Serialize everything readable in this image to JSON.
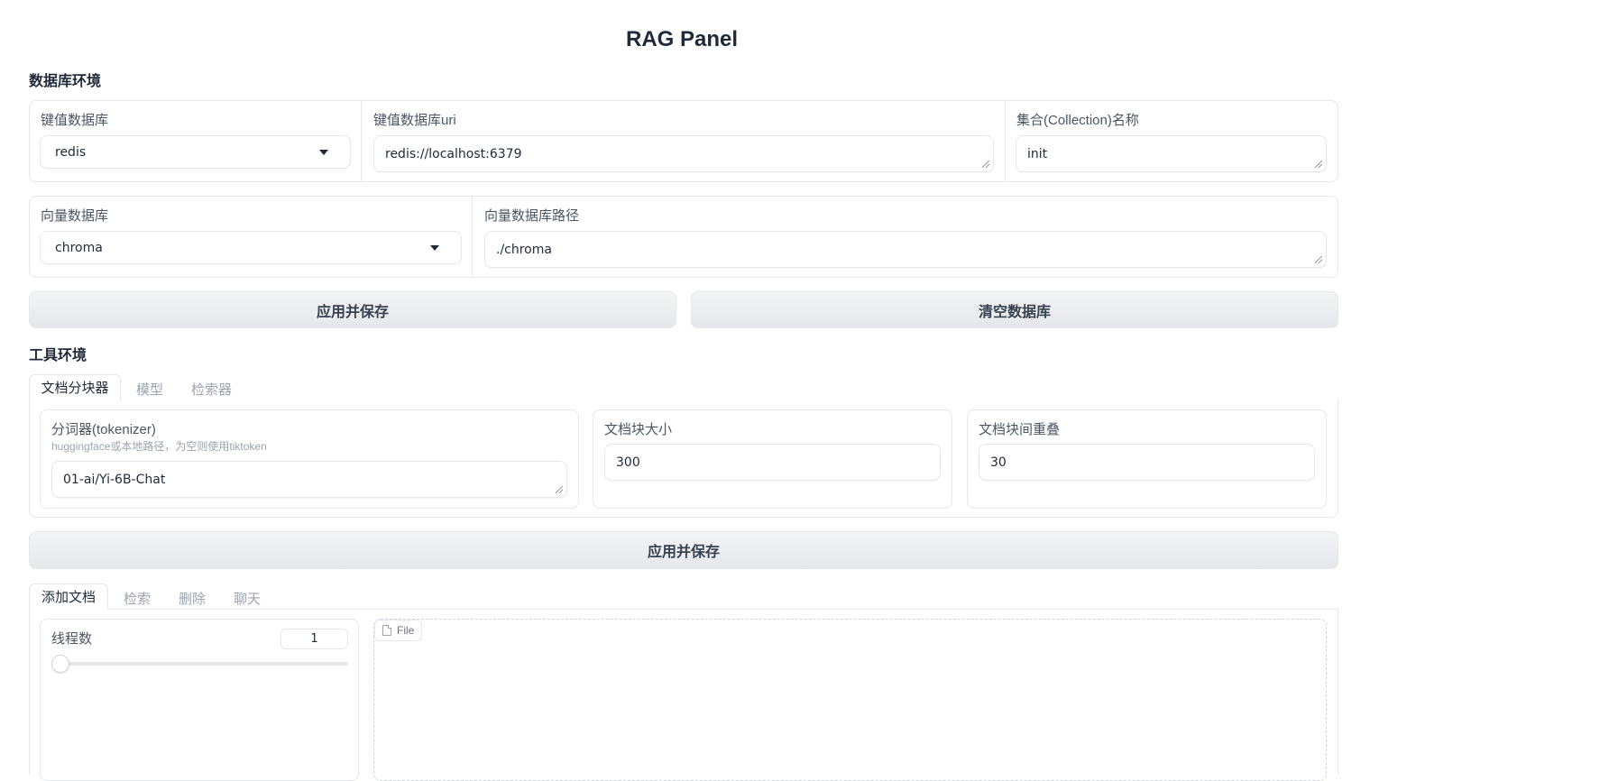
{
  "title": "RAG Panel",
  "db_env": {
    "heading": "数据库环境",
    "kv_db": {
      "label": "键值数据库",
      "value": "redis"
    },
    "kv_uri": {
      "label": "键值数据库uri",
      "value": "redis://localhost:6379"
    },
    "collection": {
      "label": "集合(Collection)名称",
      "value": "init"
    },
    "vector_db": {
      "label": "向量数据库",
      "value": "chroma"
    },
    "vector_path": {
      "label": "向量数据库路径",
      "value": "./chroma"
    },
    "save_label": "应用并保存",
    "clear_label": "清空数据库"
  },
  "tool_env": {
    "heading": "工具环境",
    "tabs": [
      "文档分块器",
      "模型",
      "检索器"
    ],
    "tokenizer": {
      "label": "分词器(tokenizer)",
      "info": "huggingface或本地路径，为空则使用tiktoken",
      "value": "01-ai/Yi-6B-Chat"
    },
    "chunk_size": {
      "label": "文档块大小",
      "value": "300"
    },
    "chunk_overlap": {
      "label": "文档块间重叠",
      "value": "30"
    },
    "save_label": "应用并保存"
  },
  "ops": {
    "tabs": [
      "添加文档",
      "检索",
      "删除",
      "聊天"
    ],
    "threads": {
      "label": "线程数",
      "value": "1",
      "slider_fraction": 0
    },
    "file_label": "File"
  }
}
